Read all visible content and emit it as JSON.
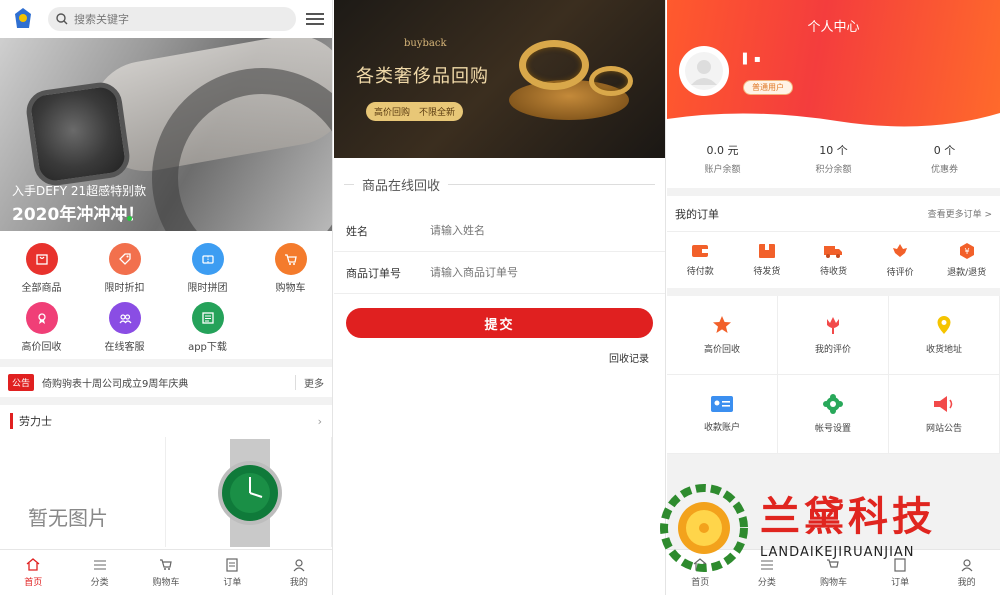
{
  "panel1": {
    "search_placeholder": "搜索关键字",
    "banner": {
      "caption1": "入手DEFY 21超感特别款",
      "caption2": "2020年冲冲冲！"
    },
    "categories": [
      {
        "label": "全部商品",
        "icon": "bag-icon",
        "color": "#e8322d"
      },
      {
        "label": "限时折扣",
        "icon": "tag-icon",
        "color": "#f2704d"
      },
      {
        "label": "限时拼团",
        "icon": "ticket-icon",
        "color": "#3d9df2"
      },
      {
        "label": "购物车",
        "icon": "cart-icon",
        "color": "#f47b2c"
      },
      {
        "label": "高价回收",
        "icon": "recycle-icon",
        "color": "#f03f77"
      },
      {
        "label": "在线客服",
        "icon": "service-icon",
        "color": "#8a4de4"
      },
      {
        "label": "app下载",
        "icon": "download-icon",
        "color": "#25a25a"
      }
    ],
    "notice": {
      "tag": "公告",
      "text": "倚购驹表十周公司成立9周年庆典",
      "more": "更多"
    },
    "section_title": "劳力士",
    "no_image": "暂无图片",
    "tabs": [
      {
        "label": "首页",
        "icon": "home-icon"
      },
      {
        "label": "分类",
        "icon": "list-icon"
      },
      {
        "label": "购物车",
        "icon": "cart-icon"
      },
      {
        "label": "订单",
        "icon": "order-icon"
      },
      {
        "label": "我的",
        "icon": "user-icon"
      }
    ]
  },
  "panel2": {
    "banner": {
      "small": "buyback",
      "big": "各类奢侈品回购",
      "pill": "高价回购　不限全新"
    },
    "form_title": "商品在线回收",
    "fields": [
      {
        "label": "姓名",
        "placeholder": "请输入姓名"
      },
      {
        "label": "商品订单号",
        "placeholder": "请输入商品订单号"
      }
    ],
    "submit": "提交",
    "records": "回收记录"
  },
  "panel3": {
    "title": "个人中心",
    "user_badge": "普通用户",
    "stats": [
      {
        "value": "0.0 元",
        "label": "账户余额"
      },
      {
        "value": "10 个",
        "label": "积分余额"
      },
      {
        "value": "0 个",
        "label": "优惠券"
      }
    ],
    "orders": {
      "title": "我的订单",
      "more": "查看更多订单 >",
      "items": [
        {
          "label": "待付款",
          "icon": "wallet-icon"
        },
        {
          "label": "待发货",
          "icon": "box-icon"
        },
        {
          "label": "待收货",
          "icon": "truck-icon"
        },
        {
          "label": "待评价",
          "icon": "flower-icon"
        },
        {
          "label": "退款/退货",
          "icon": "refund-icon"
        }
      ]
    },
    "grid": [
      {
        "label": "高价回收",
        "icon": "star-icon"
      },
      {
        "label": "我的评价",
        "icon": "tulip-icon"
      },
      {
        "label": "收货地址",
        "icon": "location-icon"
      },
      {
        "label": "收款账户",
        "icon": "card-icon"
      },
      {
        "label": "帐号设置",
        "icon": "gear-icon"
      },
      {
        "label": "网站公告",
        "icon": "megaphone-icon"
      }
    ],
    "tabs": [
      "首页",
      "分类",
      "购物车",
      "订单",
      "我的"
    ]
  },
  "watermark": {
    "cn": "兰黛科技",
    "en": "LANDAIKEJIRUANJIAN"
  },
  "colors": {
    "accent": "#e02020",
    "header_gradient_start": "#ff5a2d",
    "header_gradient_end": "#f43d3d"
  }
}
